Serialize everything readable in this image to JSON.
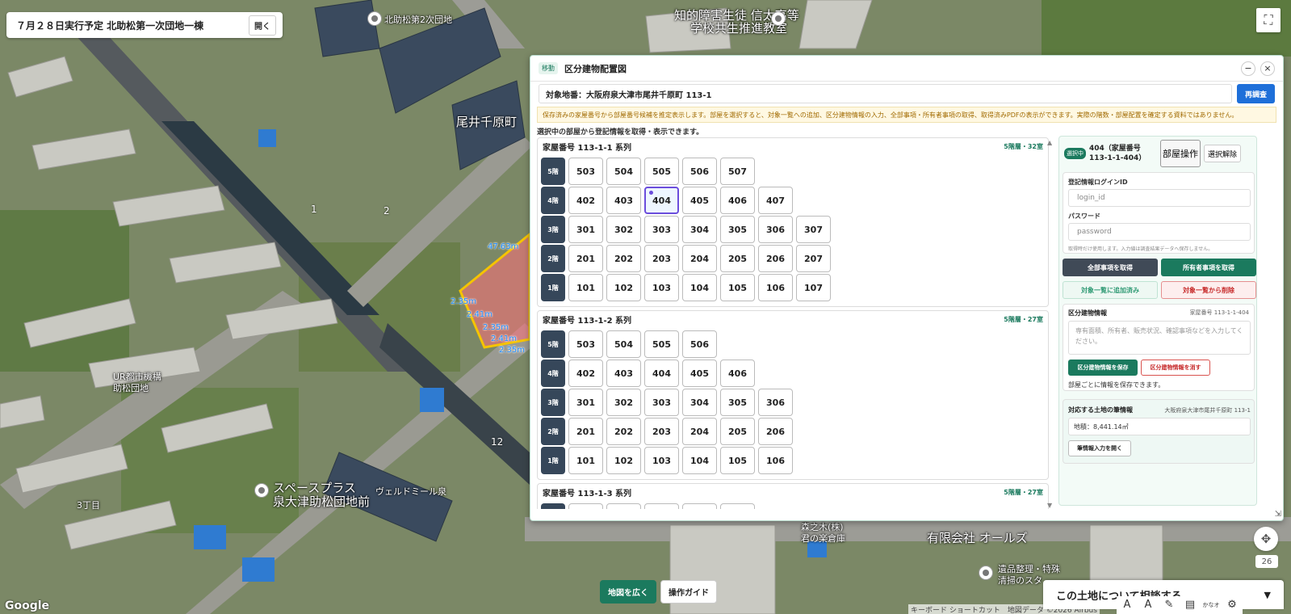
{
  "plan_chip": {
    "title": "７月２８日実行予定 北助松第一次団地一棟",
    "open_label": "開く"
  },
  "map": {
    "labels": {
      "kitasuke2": "北助松第2次団地",
      "welfare": "知的障害生徒 信太高等",
      "welfare2": "学校共生推進教室",
      "oi": "尾井千原町",
      "ur": "UR都市機構",
      "ur2": "助松団地",
      "space": "スペースプラス",
      "space2": "泉大津助松団地前",
      "chome3": "3丁目",
      "vert": "ヴェルドミール泉",
      "oils": "有限会社 オールズ",
      "cleanup": "遺品整理・特殊",
      "cleanup2": "清掃のスタ",
      "warehouse": "森之木(株)",
      "warehouse2": "君の楽倉庫",
      "n1": "1",
      "n2": "2",
      "n12": "12",
      "d1": "47.63m",
      "d2": "2.35m",
      "d3": "2.41m",
      "d4": "2.35m",
      "d5": "2.41m",
      "d6": "2.35m"
    },
    "google": "Google",
    "attribution": "キーボード ショートカット　地図データ ©2026 Airbus",
    "badge": "26"
  },
  "bottom_buttons": {
    "zoom": "地図を広く",
    "guide": "操作ガイド"
  },
  "detail_bar": {
    "title": "この土地について相談する",
    "chevron": "▼"
  },
  "tools": [
    "A",
    "A",
    "✎",
    "▤",
    "かなオフ",
    "⚙"
  ],
  "panel": {
    "move_tag": "移動",
    "title": "区分建物配置図",
    "minimize": "−",
    "close": "×",
    "target": "対象地番：大阪府泉大津市尾井千原町 113-1",
    "reresearch": "再調査",
    "notice": "保存済みの家屋番号から部屋番号候補を推定表示します。部屋を選択すると、対象一覧への追加、区分建物情報の入力、全部事項・所有者事項の取得、取得済みPDFの表示ができます。実際の階数・部屋配置を確定する資料ではありません。",
    "caption": "選択中の部屋から登記情報を取得・表示できます。"
  },
  "series": [
    {
      "title": "家屋番号 113-1-1 系列",
      "meta": "5階層・32室",
      "floors": [
        {
          "label": "5階",
          "rooms": [
            "503",
            "504",
            "505",
            "506",
            "507"
          ]
        },
        {
          "label": "4階",
          "rooms": [
            "402",
            "403",
            "404",
            "405",
            "406",
            "407"
          ]
        },
        {
          "label": "3階",
          "rooms": [
            "301",
            "302",
            "303",
            "304",
            "305",
            "306",
            "307"
          ]
        },
        {
          "label": "2階",
          "rooms": [
            "201",
            "202",
            "203",
            "204",
            "205",
            "206",
            "207"
          ]
        },
        {
          "label": "1階",
          "rooms": [
            "101",
            "102",
            "103",
            "104",
            "105",
            "106",
            "107"
          ]
        }
      ]
    },
    {
      "title": "家屋番号 113-1-2 系列",
      "meta": "5階層・27室",
      "floors": [
        {
          "label": "5階",
          "rooms": [
            "503",
            "504",
            "505",
            "506"
          ]
        },
        {
          "label": "4階",
          "rooms": [
            "402",
            "403",
            "404",
            "405",
            "406"
          ]
        },
        {
          "label": "3階",
          "rooms": [
            "301",
            "302",
            "303",
            "304",
            "305",
            "306"
          ]
        },
        {
          "label": "2階",
          "rooms": [
            "201",
            "202",
            "203",
            "204",
            "205",
            "206"
          ]
        },
        {
          "label": "1階",
          "rooms": [
            "101",
            "102",
            "103",
            "104",
            "105",
            "106"
          ]
        }
      ]
    },
    {
      "title": "家屋番号 113-1-3 系列",
      "meta": "5階層・27室",
      "floors": [
        {
          "label": "5階",
          "rooms": [
            "",
            "",
            "",
            "",
            ""
          ]
        }
      ]
    }
  ],
  "selection": {
    "tag": "選択中",
    "title": "404（家屋番号 113-1-1-404）",
    "room_op": "部屋操作",
    "deselect": "選択解除",
    "login_label": "登記情報ログインID",
    "login_placeholder": "login_id",
    "password_label": "パスワード",
    "password_placeholder": "password",
    "cred_note": "取得時だけ使用します。入力値は調査結果データへ保存しません。",
    "get_all": "全部事項を取得",
    "get_owner": "所有者事項を取得",
    "added": "対象一覧に追加済み",
    "remove": "対象一覧から削除",
    "div_info_title": "区分建物情報",
    "div_info_no": "家屋番号 113-1-1-404",
    "div_info_placeholder": "専有面積、所有者、販売状況、確認事項などを入力してください。",
    "save_div": "区分建物情報を保存",
    "clear_div": "区分建物情報を消す",
    "save_note": "部屋ごとに情報を保存できます。",
    "land_title": "対応する土地の筆情報",
    "land_addr": "大阪府泉大津市尾井千原町 113-1",
    "land_area": "地積：8,441.14㎡",
    "open_lot": "筆情報入力を開く"
  },
  "colors": {
    "accent": "#1b7a5e",
    "dark": "#36475a",
    "danger": "#c62828",
    "blue": "#1e6fd9",
    "select": "#6b4ddc"
  }
}
